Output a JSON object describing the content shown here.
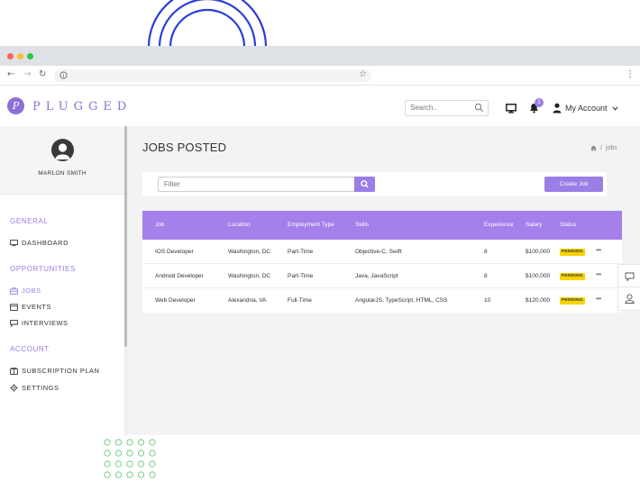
{
  "colors": {
    "accent": "#9b7ee6",
    "table_header": "#a57fea",
    "pending": "#f7d300"
  },
  "brand": {
    "name": "PLUGGED",
    "mark": "P"
  },
  "header": {
    "search_placeholder": "Search..",
    "account_label": "My Account",
    "notification_count": "1"
  },
  "sidebar": {
    "user_name": "MARLON SMITH",
    "sections": [
      {
        "title": "GENERAL",
        "items": [
          {
            "label": "DASHBOARD",
            "icon": "monitor-icon"
          }
        ]
      },
      {
        "title": "OPPORTUNITIES",
        "items": [
          {
            "label": "JOBS",
            "icon": "briefcase-icon",
            "active": true
          },
          {
            "label": "EVENTS",
            "icon": "calendar-icon"
          },
          {
            "label": "INTERVIEWS",
            "icon": "chat-icon"
          }
        ]
      },
      {
        "title": "ACCOUNT",
        "items": [
          {
            "label": "SUBSCRIPTION PLAN",
            "icon": "package-icon"
          },
          {
            "label": "SETTINGS",
            "icon": "gear-icon"
          }
        ]
      }
    ]
  },
  "main": {
    "title": "JOBS POSTED",
    "breadcrumb": {
      "separator": "/",
      "current": "jobs"
    },
    "filter_placeholder": "Filter",
    "create_button": "Create Job",
    "table": {
      "columns": [
        "Job",
        "Location",
        "Employment Type",
        "Skills",
        "Experience",
        "Salary",
        "Status"
      ],
      "rows": [
        {
          "job": "IOS Developer",
          "location": "Washington, DC",
          "type": "Part-Time",
          "skills": "Objective-C, Swift",
          "experience": "8",
          "salary": "$100,000",
          "status": "PENDING"
        },
        {
          "job": "Android Developer",
          "location": "Washington, DC",
          "type": "Part-Time",
          "skills": "Java, JavaScript",
          "experience": "8",
          "salary": "$100,000",
          "status": "PENDING"
        },
        {
          "job": "Web Developer",
          "location": "Alexandria, VA",
          "type": "Full-Time",
          "skills": "AngularJS, TypeScript, HTML, CSS",
          "experience": "10",
          "salary": "$120,000",
          "status": "PENDING"
        }
      ]
    }
  }
}
